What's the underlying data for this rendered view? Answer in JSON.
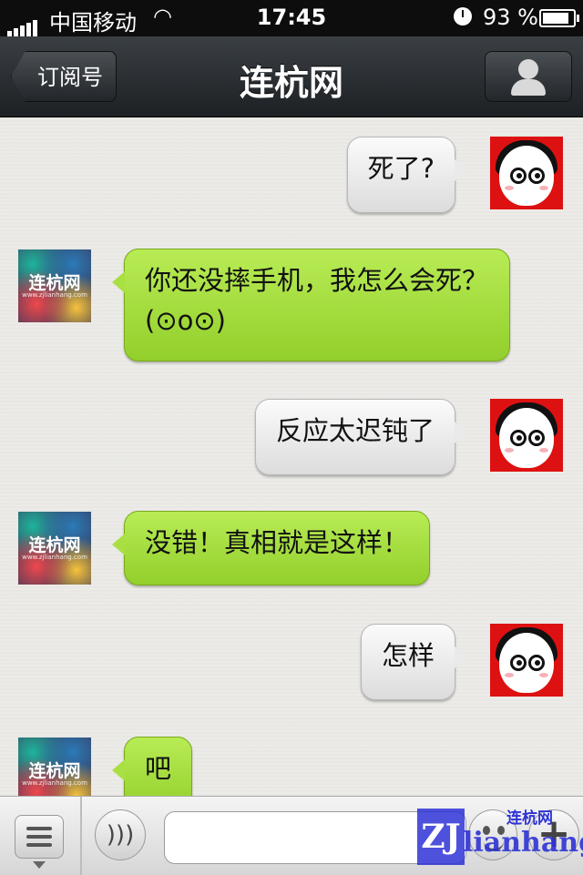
{
  "status_bar": {
    "carrier": "中国移动",
    "time": "17:45",
    "battery_percent": "93 %",
    "battery_level": 0.93,
    "signal_icon": "signal-bars-icon",
    "wifi_icon": "wifi-icon",
    "clock_icon": "alarm-clock-icon"
  },
  "navbar": {
    "back_label": "订阅号",
    "title": "连杭网",
    "profile_icon": "person-icon"
  },
  "messages": [
    {
      "side": "user",
      "text": "死了?"
    },
    {
      "side": "bot",
      "text": "你还没摔手机，我怎么会死？(⊙o⊙)"
    },
    {
      "side": "user",
      "text": "反应太迟钝了"
    },
    {
      "side": "bot",
      "text": "没错！真相就是这样！"
    },
    {
      "side": "user",
      "text": "怎样"
    },
    {
      "side": "bot",
      "text": "吧"
    }
  ],
  "bot_avatar": {
    "brand": "连杭网",
    "domain": "www.zjlianhang.com"
  },
  "toolbar": {
    "menu_icon": "list-menu-icon",
    "voice_icon": "voice-icon",
    "input_value": "",
    "emoji_icon": "smiley-icon",
    "plus_icon": "plus-icon"
  },
  "watermark": {
    "mark": "ZJ",
    "cn": "连杭网",
    "latin": "lianhang"
  },
  "colors": {
    "bot_bubble": "#a8e044",
    "user_bubble": "#eaeaea",
    "user_avatar_bg": "#dd1111",
    "navbar": "#2a2e32"
  }
}
